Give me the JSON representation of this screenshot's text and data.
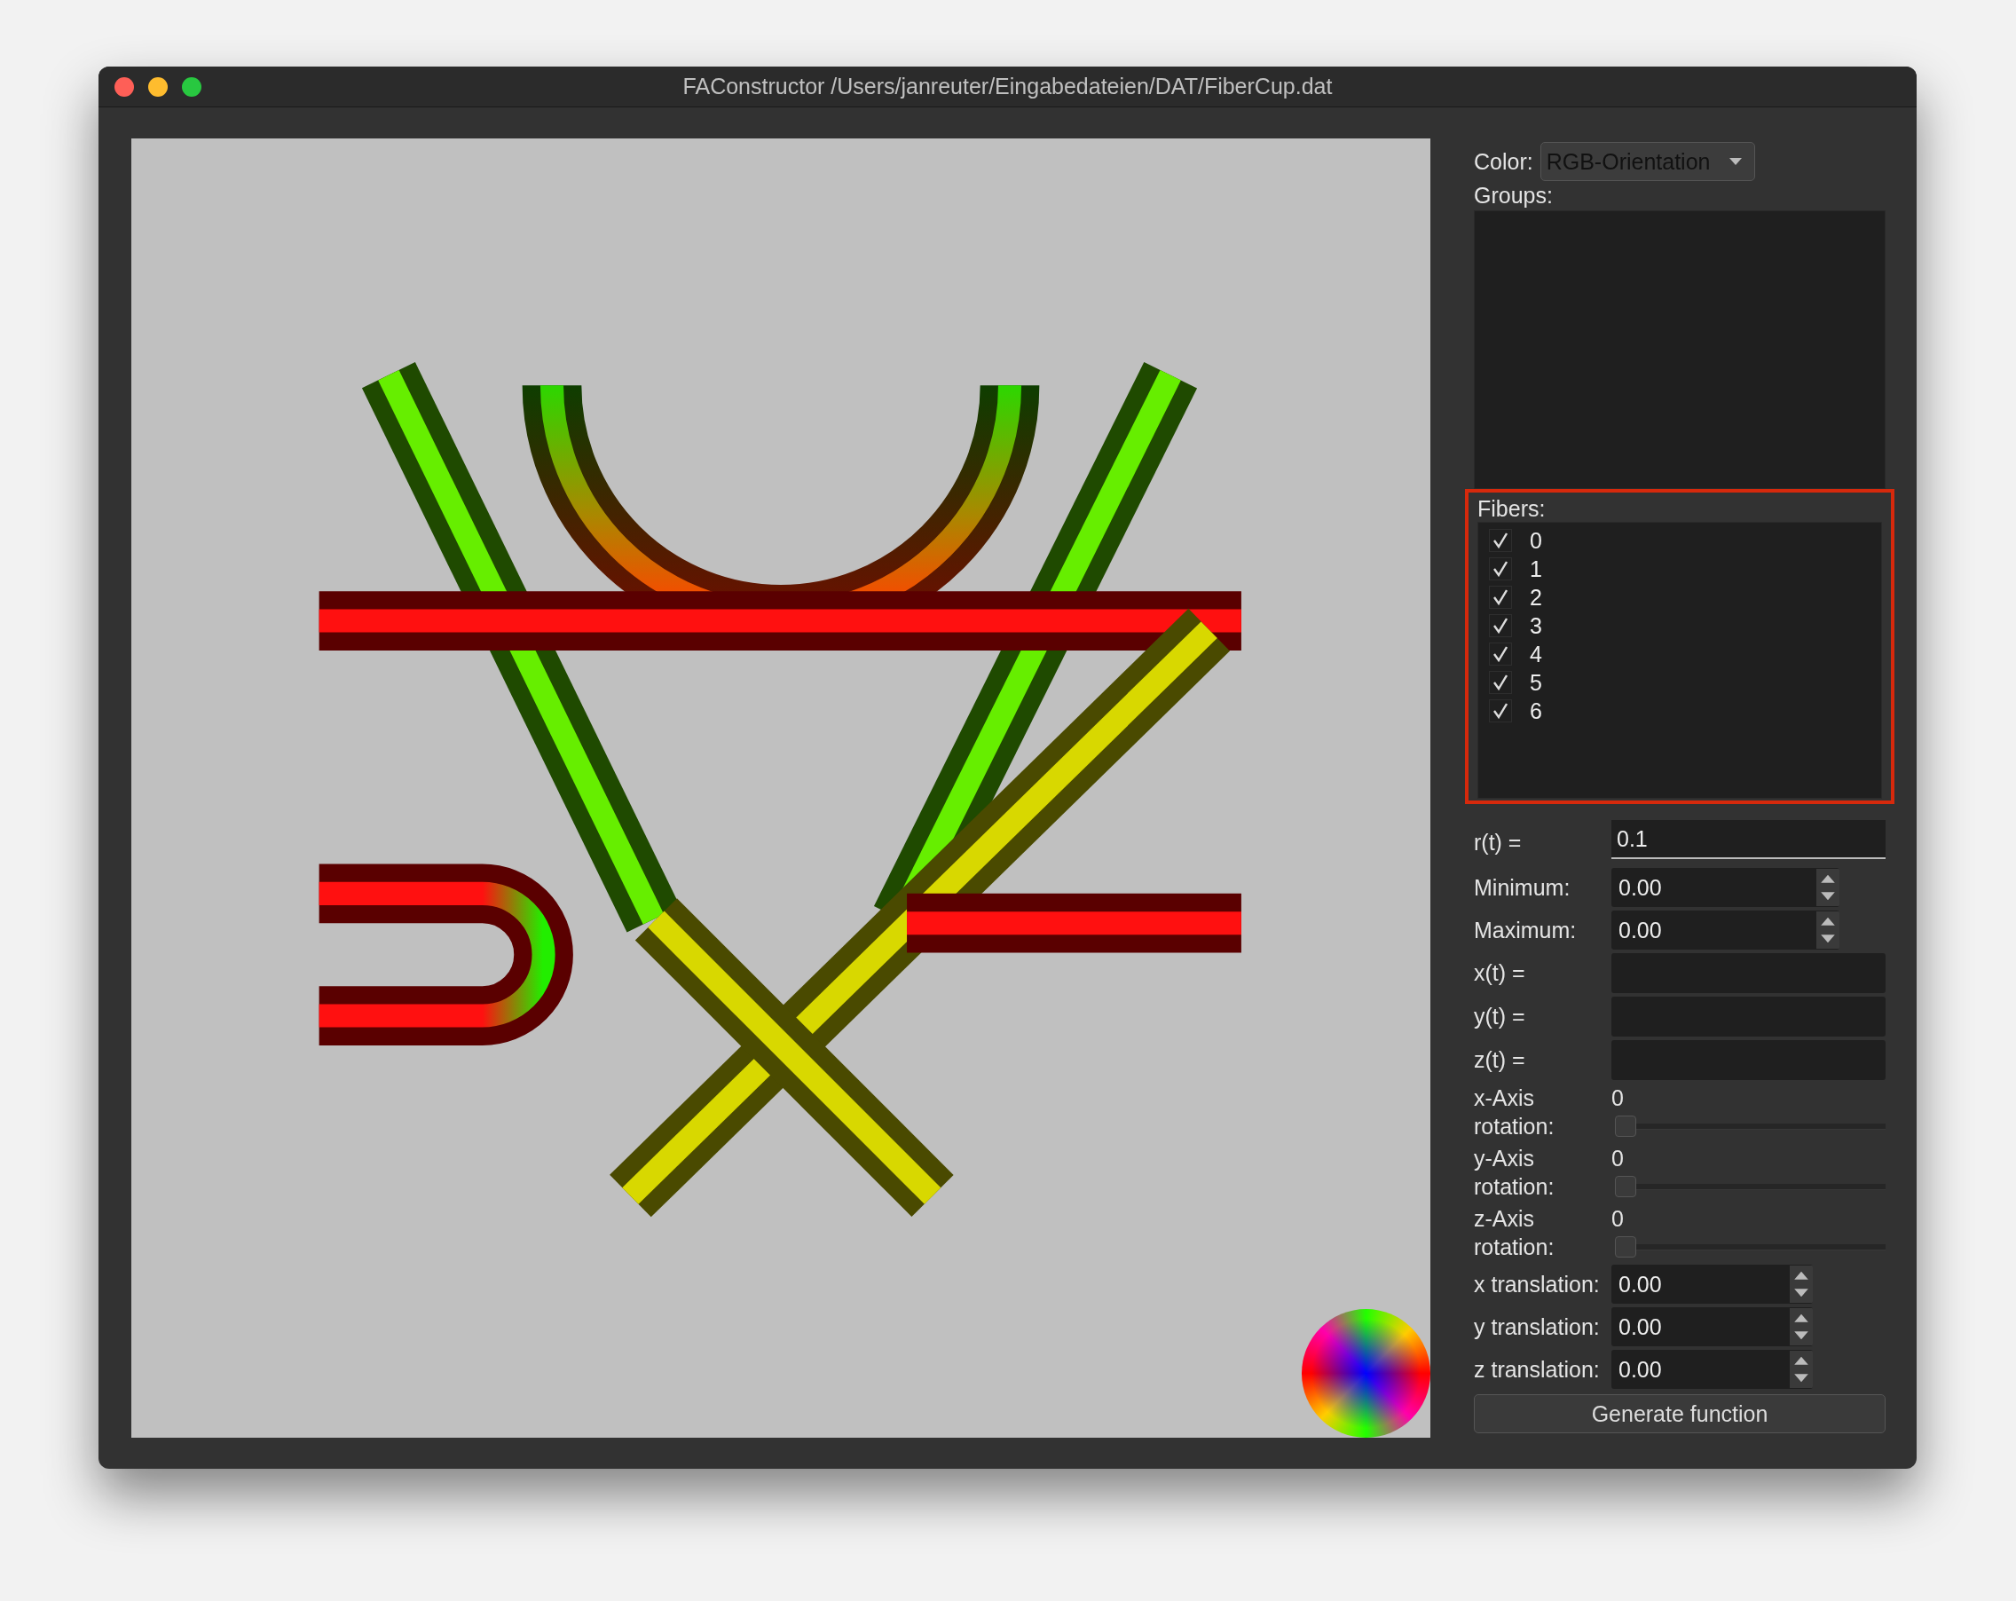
{
  "window": {
    "title": "FAConstructor /Users/janreuter/Eingabedateien/DAT/FiberCup.dat"
  },
  "color": {
    "label": "Color:",
    "value": "RGB-Orientation"
  },
  "groups": {
    "label": "Groups:"
  },
  "fibers": {
    "label": "Fibers:",
    "highlighted": true,
    "items": [
      {
        "label": "0",
        "checked": true
      },
      {
        "label": "1",
        "checked": true
      },
      {
        "label": "2",
        "checked": true
      },
      {
        "label": "3",
        "checked": true
      },
      {
        "label": "4",
        "checked": true
      },
      {
        "label": "5",
        "checked": true
      },
      {
        "label": "6",
        "checked": true
      }
    ]
  },
  "radius": {
    "label": "r(t) =",
    "value": "0.1"
  },
  "range": [
    {
      "label": "Minimum:",
      "value": "0.00"
    },
    {
      "label": "Maximum:",
      "value": "0.00"
    }
  ],
  "functions": [
    {
      "label": "x(t) ="
    },
    {
      "label": "y(t) ="
    },
    {
      "label": "z(t) ="
    }
  ],
  "rotations": [
    {
      "label": "x-Axis rotation:",
      "value": "0",
      "level": 0
    },
    {
      "label": "y-Axis rotation:",
      "value": "0",
      "level": 0
    },
    {
      "label": "z-Axis rotation:",
      "value": "0",
      "level": 0
    }
  ],
  "translations": [
    {
      "label": "x translation:",
      "value": "0.00"
    },
    {
      "label": "y translation:",
      "value": "0.00"
    },
    {
      "label": "z translation:",
      "value": "0.00"
    }
  ],
  "button": "Generate function"
}
